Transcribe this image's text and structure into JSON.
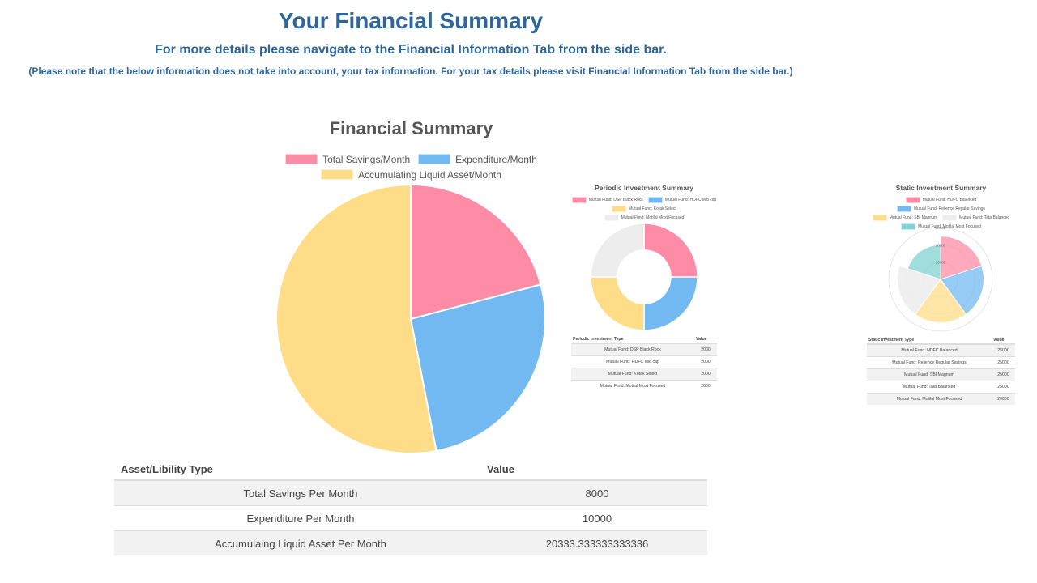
{
  "header": {
    "title": "Your Financial Summary",
    "subtitle": "For more details please navigate to the Financial Information Tab from the side bar.",
    "note": "(Please note that the below information does not take into account, your tax information. For your tax details please visit Financial Information Tab from the side bar.)"
  },
  "colors": {
    "pink": "#ff8ca6",
    "blue": "#72b9f2",
    "yellow": "#ffdd88",
    "grey": "#ededee",
    "teal": "#7fd3d2",
    "heading": "#2f6699"
  },
  "chart_data": [
    {
      "type": "pie",
      "title": "Financial Summary",
      "categories": [
        "Total Savings/Month",
        "Expenditure/Month",
        "Accumulating Liquid Asset/Month"
      ],
      "values": [
        8000,
        10000,
        20333.333333333336
      ],
      "colors": [
        "#ff8ca6",
        "#72b9f2",
        "#ffdd88"
      ],
      "legend": "top"
    },
    {
      "type": "pie",
      "subtype": "doughnut",
      "title": "Periodic Investment Summary",
      "categories": [
        "Mutual Fund: DSP Black Rock",
        "Mutual Fund: HDFC Mid cap",
        "Mutual Fund: Kotak Select",
        "Mutual Fund: Motilal Most Focused"
      ],
      "values": [
        2000,
        2000,
        2000,
        2000
      ],
      "colors": [
        "#ff8ca6",
        "#72b9f2",
        "#ffdd88",
        "#ededee"
      ],
      "legend": "top"
    },
    {
      "type": "polar-area",
      "title": "Static Investment Summary",
      "categories": [
        "Mutual Fund: HDFC Balanced",
        "Mutual Fund: Relience Regular Savings",
        "Mutual Fund: SBI Magnum",
        "Mutual Fund: Tata Balanced",
        "Mutual Fund: Motilal Most Focused"
      ],
      "values": [
        25000,
        25000,
        25000,
        25000,
        20000
      ],
      "colors": [
        "#ff8ca6",
        "#72b9f2",
        "#ffdd88",
        "#ededee",
        "#7fd3d2"
      ],
      "rlim": [
        0,
        30000
      ],
      "ticks": [
        "10000",
        "20000",
        "30000"
      ],
      "legend": "top"
    }
  ],
  "main_table": {
    "headers": [
      "Asset/Libility Type",
      "Value"
    ],
    "rows": [
      [
        "Total Savings Per Month",
        "8000"
      ],
      [
        "Expenditure Per Month",
        "10000"
      ],
      [
        "Accumulaing Liquid Asset Per Month",
        "20333.333333333336"
      ]
    ]
  },
  "periodic_table": {
    "headers": [
      "Periodic Investment Type",
      "Value"
    ],
    "rows": [
      [
        "Mutual Fund: DSP Black Rock",
        "2000"
      ],
      [
        "Mutual Fund: HDFC Mid cap",
        "2000"
      ],
      [
        "Mutual Fund: Kotak Select",
        "2000"
      ],
      [
        "Mutual Fund: Motilal Most Focused",
        "2000"
      ]
    ]
  },
  "static_table": {
    "headers": [
      "Static Investment Type",
      "Value"
    ],
    "rows": [
      [
        "Mutual Fund: HDFC Balanced",
        "25000"
      ],
      [
        "Mutual Fund: Relience Regular Savings",
        "25000"
      ],
      [
        "Mutual Fund: SBI Magnum",
        "25000"
      ],
      [
        "Mutual Fund: Tata Balanced",
        "25000"
      ],
      [
        "Mutual Fund: Motilal Most Focused",
        "20000"
      ]
    ]
  }
}
